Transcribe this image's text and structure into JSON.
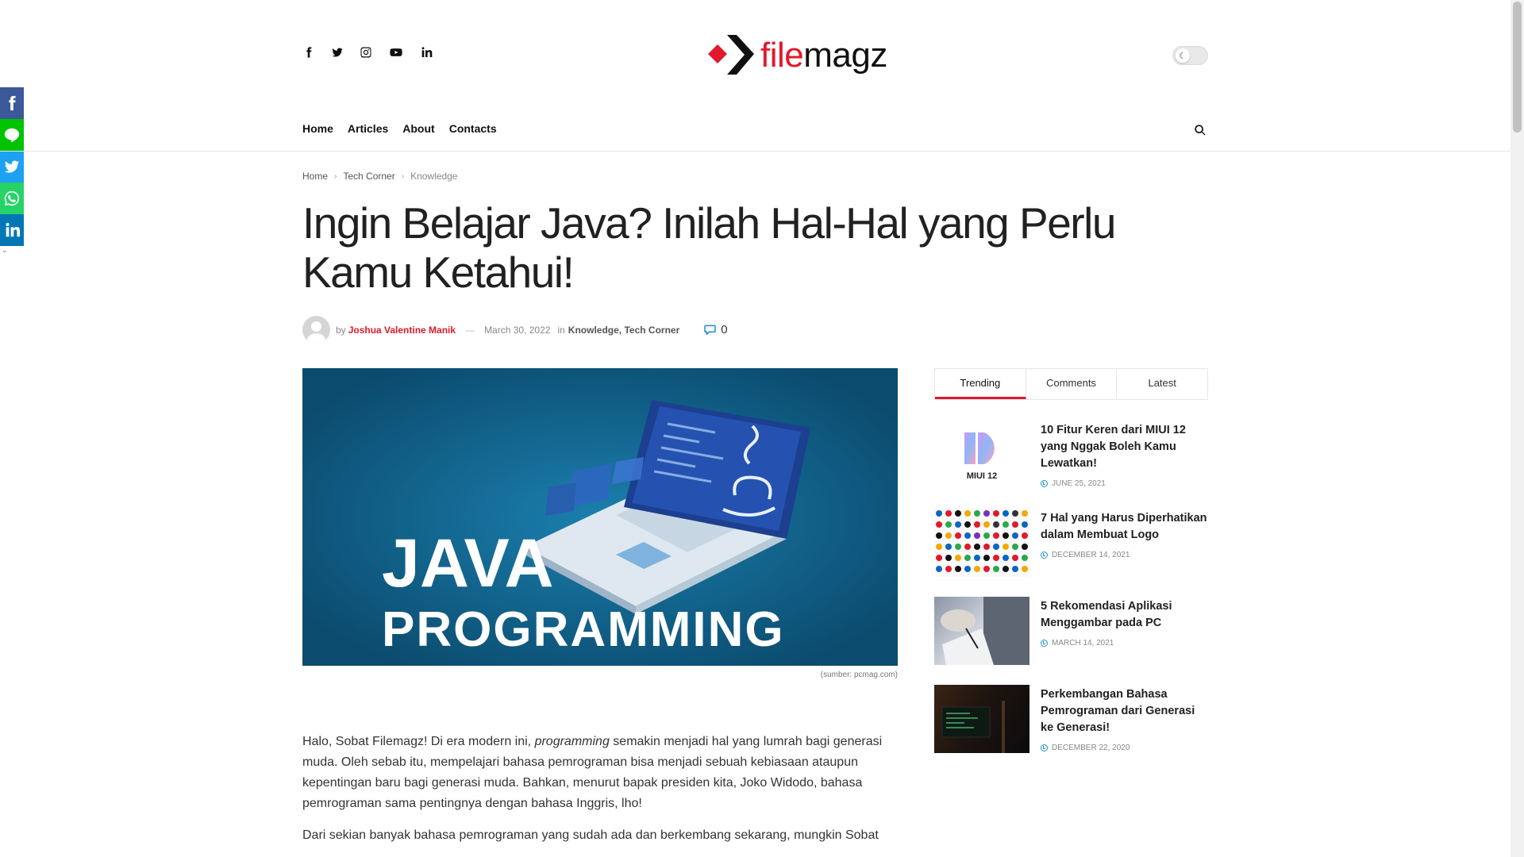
{
  "share_bar": {
    "items": [
      "facebook-icon",
      "line-icon",
      "twitter-icon",
      "whatsapp-icon",
      "linkedin-icon"
    ],
    "more": "⌄"
  },
  "header": {
    "social": [
      "facebook-icon",
      "twitter-icon",
      "instagram-icon",
      "youtube-icon",
      "linkedin-icon"
    ],
    "logo": {
      "part1": "file",
      "part2": "magz"
    },
    "nav": [
      "Home",
      "Articles",
      "About",
      "Contacts"
    ],
    "dark_mode_icon": "☾"
  },
  "breadcrumb": [
    "Home",
    "Tech Corner",
    "Knowledge"
  ],
  "article": {
    "title": "Ingin Belajar Java? Inilah Hal-Hal yang Perlu Kamu Ketahui!",
    "by": "by",
    "author": "Joshua Valentine Manik",
    "dash": "—",
    "date": "March 30, 2022",
    "in": "in",
    "categories": "Knowledge, Tech Corner",
    "comment_count": "0",
    "image": {
      "line1": "JAVA",
      "line2": "PROGRAMMING"
    },
    "caption": "(sumber: pcmag.com)",
    "p1_a": "Halo, Sobat Filemagz! Di era modern ini, ",
    "p1_em": "programming",
    "p1_b": " semakin menjadi hal yang lumrah bagi generasi muda. Oleh sebab itu, mempelajari bahasa pemrograman bisa menjadi sebuah kebiasaan ataupun kepentingan baru bagi generasi muda. Bahkan, menurut bapak presiden kita, Joko Widodo, bahasa pemrograman sama pentingnya dengan bahasa Inggris, lho!",
    "p2": "Dari sekian banyak bahasa pemrograman yang sudah ada dan berkembang sekarang, mungkin Sobat"
  },
  "sidebar": {
    "tabs": [
      "Trending",
      "Comments",
      "Latest"
    ],
    "items": [
      {
        "title": "10 Fitur Keren dari MIUI 12 yang Nggak Boleh Kamu Lewatkan!",
        "date": "JUNE 25, 2021",
        "thumb_label": "MIUI 12"
      },
      {
        "title": "7 Hal yang Harus Diperhatikan dalam Membuat Logo",
        "date": "DECEMBER 14, 2021"
      },
      {
        "title": "5 Rekomendasi Aplikasi Menggambar pada PC",
        "date": "MARCH 14, 2021"
      },
      {
        "title": "Perkembangan Bahasa Pemrograman dari Generasi ke Generasi!",
        "date": "DECEMBER 22, 2020"
      }
    ]
  },
  "colors": {
    "brand_red": "#e0192c",
    "accent_blue": "#1a8fd1",
    "hero_bg": "#0e5a82"
  }
}
